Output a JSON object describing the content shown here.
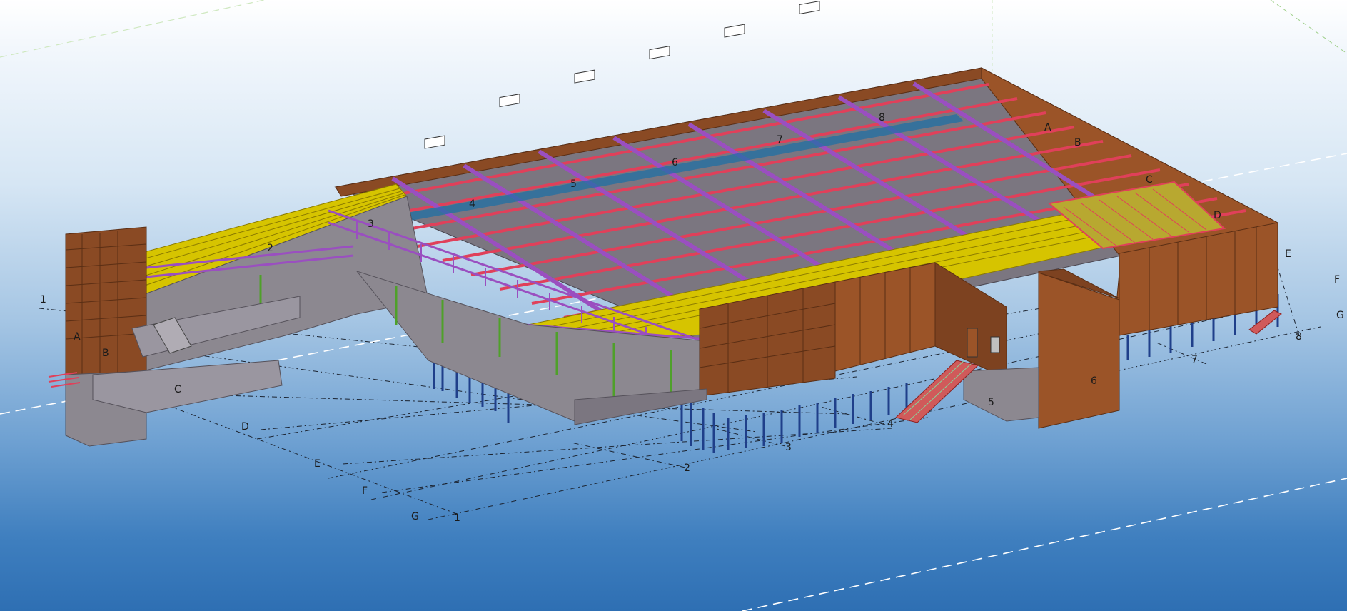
{
  "view": {
    "type": "3d-model-view",
    "background_top": "#ffffff",
    "background_bottom": "#2e6fb3"
  },
  "grid_labels": {
    "rear_numbers": [
      "1",
      "2",
      "3",
      "4",
      "5",
      "6",
      "7",
      "8"
    ],
    "rear_letters": [
      "A",
      "B",
      "C",
      "D",
      "E",
      "F",
      "G"
    ],
    "front_letters": [
      "A",
      "B",
      "C",
      "D",
      "E",
      "F",
      "G"
    ],
    "front_numbers": [
      "1",
      "2",
      "3",
      "4",
      "5",
      "6",
      "7",
      "8"
    ]
  },
  "colors": {
    "wall": "#8a4a24",
    "wall_dark": "#6e3a1c",
    "slab": "#8c8890",
    "beam_red": "#e0405a",
    "truss_purple": "#9a4fc0",
    "joist_yellow": "#d6c400",
    "column_blue": "#1f3f8a",
    "column_green": "#4fa02a",
    "stair_red": "#c83c3c"
  }
}
